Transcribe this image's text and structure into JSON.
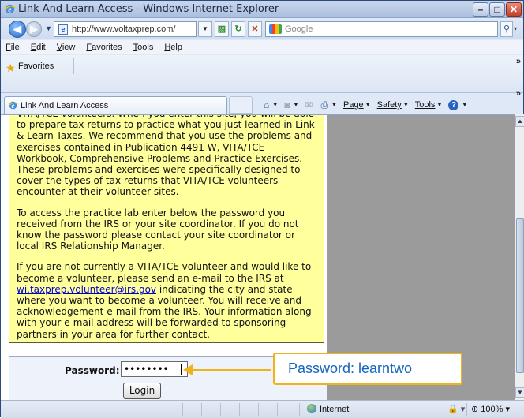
{
  "window": {
    "title": "Link And Learn Access - Windows Internet Explorer",
    "minimize": "–",
    "maximize": "□",
    "close": "✕"
  },
  "address_bar": {
    "url": "http://www.voltaxprep.com/",
    "page_icon": "e"
  },
  "search": {
    "placeholder": "Google",
    "button": "⚲",
    "dropdown": "▾"
  },
  "menu": [
    "File",
    "Edit",
    "View",
    "Favorites",
    "Tools",
    "Help"
  ],
  "favorites_bar": {
    "label": "Favorites",
    "overflow": "»"
  },
  "tab": {
    "label": "Link And Learn Access"
  },
  "command_bar": {
    "page": "Page",
    "safety": "Safety",
    "tools": "Tools",
    "overflow": "»"
  },
  "content": {
    "paragraphs": [
      "VITA/TCE volunteers. When you enter this site, you will be able to prepare tax returns to practice what you just learned in Link & Learn Taxes. We recommend that you use the problems and exercises contained in Publication 4491 W, VITA/TCE Workbook, Comprehensive Problems and Practice Exercises. These problems and exercises were specifically designed to cover the types of tax returns that VITA/TCE volunteers encounter at their volunteer sites.",
      "To access the practice lab enter below the password you received from the IRS or your site coordinator. If you do not know the password please contact your site coordinator or local IRS Relationship Manager."
    ],
    "p3_before": "If you are not currently a VITA/TCE volunteer and would like to become a volunteer, please send an e-mail to the IRS at ",
    "p3_link": "wi.taxprep.volunteer@irs.gov",
    "p3_after": " indicating the city and state where you want to become a volunteer. You will receive and acknowledgement e-mail from the IRS. Your information along with your e-mail address will be forwarded to sponsoring partners in your area for further contact."
  },
  "login": {
    "password_label": "Password:",
    "password_value": "••••••••",
    "login_button": "Login"
  },
  "callout": {
    "text": "Password: learntwo"
  },
  "status_bar": {
    "zone": "Internet",
    "zoom": "100%",
    "protected_mode": "🔒 ▾"
  },
  "colors": {
    "content_box": "#ffff9c",
    "callout_border": "#f0b41a",
    "callout_text": "#1564c0",
    "link": "#0000cc"
  }
}
